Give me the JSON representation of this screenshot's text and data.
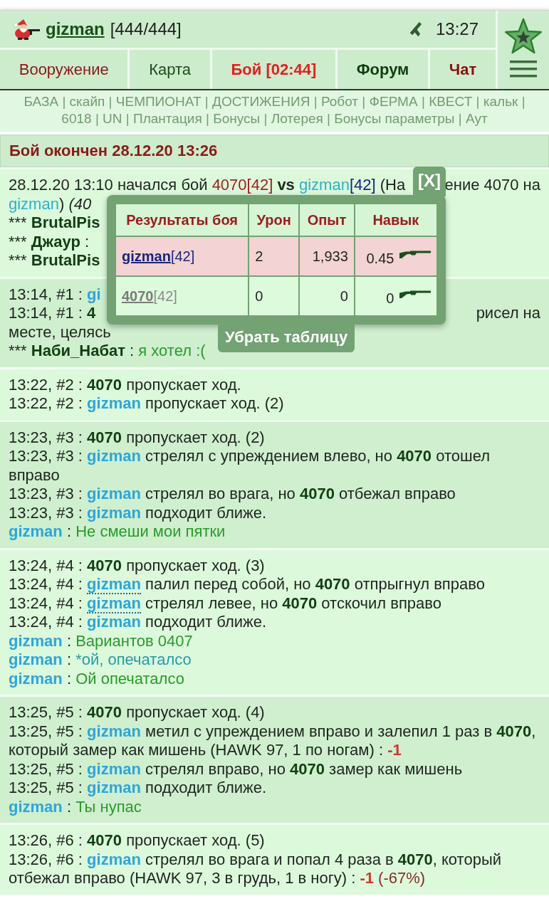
{
  "header": {
    "username": "gizman",
    "health": "[444/444]",
    "time": "13:27"
  },
  "nav": [
    {
      "label": "Вооружение",
      "color": "#8b1a1a",
      "bold": false
    },
    {
      "label": "Карта",
      "color": "#1b4d1b",
      "bold": false
    },
    {
      "label": "Бой [02:44]",
      "color": "#e02020",
      "bold": true
    },
    {
      "label": "Форум",
      "color": "#0f3d0f",
      "bold": true
    },
    {
      "label": "Чат",
      "color": "#8b1010",
      "bold": true
    }
  ],
  "links": {
    "items": [
      "БАЗА",
      "скайп",
      "ЧЕМПИОНАТ",
      "ДОСТИЖЕНИЯ",
      "Робот",
      "ФЕРМА",
      "КВЕСТ",
      "кальк",
      "6018",
      "UN",
      "Плантация",
      "Бонусы",
      "Лотерея",
      "Бонусы параметры",
      "Аут"
    ],
    "separator": "|"
  },
  "battle_title": "Бой окончен 28.12.20 13:26",
  "log": [
    {
      "lines": [
        {
          "segments": [
            {
              "text": "28.12.20 13:10 начался бой ",
              "kind": "plain"
            },
            {
              "text": "4070[42]",
              "kind": "red"
            },
            {
              "text": " vs ",
              "kind": "strong"
            },
            {
              "text": "gizman",
              "kind": "link"
            },
            {
              "text": "[42]",
              "kind": "rank"
            },
            {
              "text": " (На",
              "kind": "plain"
            }
          ],
          "after_cover": [
            {
              "text": "ение 4070 на",
              "kind": "plain"
            }
          ]
        },
        {
          "segments": [
            {
              "text": "gizman",
              "kind": "link"
            },
            {
              "text": ") ",
              "kind": "plain"
            },
            {
              "text": "(40",
              "kind": "italic"
            }
          ]
        },
        {
          "segments": [
            {
              "text": "*** ",
              "kind": "plain"
            },
            {
              "text": "BrutalPis",
              "kind": "name"
            }
          ]
        },
        {
          "segments": [
            {
              "text": "*** ",
              "kind": "plain"
            },
            {
              "text": "Джаур",
              "kind": "name"
            },
            {
              "text": " :",
              "kind": "plain"
            }
          ]
        },
        {
          "segments": [
            {
              "text": "*** ",
              "kind": "plain"
            },
            {
              "text": "BrutalPis",
              "kind": "name"
            }
          ]
        }
      ]
    },
    {
      "lines": [
        {
          "segments": [
            {
              "text": "13:14, #1 : ",
              "kind": "plain"
            },
            {
              "text": "gi",
              "kind": "nick"
            }
          ]
        },
        {
          "segments": [
            {
              "text": "13:14, #1 : ",
              "kind": "plain"
            },
            {
              "text": "4",
              "kind": "name"
            }
          ],
          "after_cover": [
            {
              "text": "рисел на",
              "kind": "plain"
            }
          ]
        },
        {
          "segments": [
            {
              "text": "месте, целясь",
              "kind": "plain"
            }
          ]
        },
        {
          "segments": [
            {
              "text": "*** ",
              "kind": "plain"
            },
            {
              "text": "Наби_Набат",
              "kind": "name"
            },
            {
              "text": " : ",
              "kind": "plain"
            },
            {
              "text": "я хотел :(",
              "kind": "chat"
            }
          ]
        }
      ]
    },
    {
      "lines": [
        {
          "segments": [
            {
              "text": "13:22, #2 : ",
              "kind": "plain"
            },
            {
              "text": "4070",
              "kind": "name"
            },
            {
              "text": " пропускает ход.",
              "kind": "plain"
            }
          ]
        },
        {
          "segments": [
            {
              "text": "13:22, #2 : ",
              "kind": "plain"
            },
            {
              "text": "gizman",
              "kind": "nick"
            },
            {
              "text": " пропускает ход. (2)",
              "kind": "plain"
            }
          ]
        }
      ]
    },
    {
      "lines": [
        {
          "segments": [
            {
              "text": "13:23, #3 : ",
              "kind": "plain"
            },
            {
              "text": "4070",
              "kind": "name"
            },
            {
              "text": " пропускает ход. (2)",
              "kind": "plain"
            }
          ]
        },
        {
          "segments": [
            {
              "text": "13:23, #3 : ",
              "kind": "plain"
            },
            {
              "text": "gizman",
              "kind": "nick"
            },
            {
              "text": " стрелял с упреждением влево, но ",
              "kind": "plain"
            },
            {
              "text": "4070",
              "kind": "name"
            },
            {
              "text": " отошел вправо",
              "kind": "plain"
            }
          ]
        },
        {
          "segments": [
            {
              "text": "13:23, #3 : ",
              "kind": "plain"
            },
            {
              "text": "gizman",
              "kind": "nick"
            },
            {
              "text": " стрелял во врага, но ",
              "kind": "plain"
            },
            {
              "text": "4070",
              "kind": "name"
            },
            {
              "text": " отбежал вправо",
              "kind": "plain"
            }
          ]
        },
        {
          "segments": [
            {
              "text": "13:23, #3 : ",
              "kind": "plain"
            },
            {
              "text": "gizman",
              "kind": "nick"
            },
            {
              "text": " подходит ближе.",
              "kind": "plain"
            }
          ]
        },
        {
          "segments": [
            {
              "text": "gizman",
              "kind": "nick"
            },
            {
              "text": " : ",
              "kind": "plain"
            },
            {
              "text": "Не смеши мои пятки",
              "kind": "chat"
            }
          ]
        }
      ]
    },
    {
      "lines": [
        {
          "segments": [
            {
              "text": "13:24, #4 : ",
              "kind": "plain"
            },
            {
              "text": "4070",
              "kind": "name"
            },
            {
              "text": " пропускает ход. (3)",
              "kind": "plain"
            }
          ]
        },
        {
          "segments": [
            {
              "text": "13:24, #4 : ",
              "kind": "plain"
            },
            {
              "text": "gizman",
              "kind": "nick_dotted"
            },
            {
              "text": " палил перед собой, но ",
              "kind": "plain"
            },
            {
              "text": "4070",
              "kind": "name"
            },
            {
              "text": " отпрыгнул вправо",
              "kind": "plain"
            }
          ]
        },
        {
          "segments": [
            {
              "text": "13:24, #4 : ",
              "kind": "plain"
            },
            {
              "text": "gizman",
              "kind": "nick_dotted"
            },
            {
              "text": " стрелял левее, но ",
              "kind": "plain"
            },
            {
              "text": "4070",
              "kind": "name"
            },
            {
              "text": " отскочил вправо",
              "kind": "plain"
            }
          ]
        },
        {
          "segments": [
            {
              "text": "13:24, #4 : ",
              "kind": "plain"
            },
            {
              "text": "gizman",
              "kind": "nick"
            },
            {
              "text": " подходит ближе.",
              "kind": "plain"
            }
          ]
        },
        {
          "segments": [
            {
              "text": "gizman",
              "kind": "nick"
            },
            {
              "text": " : ",
              "kind": "plain"
            },
            {
              "text": "Вариантов 0407",
              "kind": "chat"
            }
          ]
        },
        {
          "segments": [
            {
              "text": "gizman",
              "kind": "nick"
            },
            {
              "text": " : ",
              "kind": "plain"
            },
            {
              "text": "*ой, опечаталсо",
              "kind": "chat_alt"
            }
          ]
        },
        {
          "segments": [
            {
              "text": "gizman",
              "kind": "nick"
            },
            {
              "text": " : ",
              "kind": "plain"
            },
            {
              "text": "Ой опечаталсо",
              "kind": "chat"
            }
          ]
        }
      ]
    },
    {
      "lines": [
        {
          "segments": [
            {
              "text": "13:25, #5 : ",
              "kind": "plain"
            },
            {
              "text": "4070",
              "kind": "name"
            },
            {
              "text": " пропускает ход. (4)",
              "kind": "plain"
            }
          ]
        },
        {
          "segments": [
            {
              "text": "13:25, #5 : ",
              "kind": "plain"
            },
            {
              "text": "gizman",
              "kind": "nick"
            },
            {
              "text": " метил с упреждением вправо и залепил 1 раз в ",
              "kind": "plain"
            },
            {
              "text": "4070",
              "kind": "name"
            },
            {
              "text": ", который замер как мишень (HAWK 97, 1 по ногам) : ",
              "kind": "plain"
            },
            {
              "text": "-1",
              "kind": "damage"
            }
          ]
        },
        {
          "segments": [
            {
              "text": "13:25, #5 : ",
              "kind": "plain"
            },
            {
              "text": "gizman",
              "kind": "nick"
            },
            {
              "text": " стрелял вправо, но ",
              "kind": "plain"
            },
            {
              "text": "4070",
              "kind": "name"
            },
            {
              "text": " замер как мишень",
              "kind": "plain"
            }
          ]
        },
        {
          "segments": [
            {
              "text": "13:25, #5 : ",
              "kind": "plain"
            },
            {
              "text": "gizman",
              "kind": "nick"
            },
            {
              "text": " подходит ближе.",
              "kind": "plain"
            }
          ]
        },
        {
          "segments": [
            {
              "text": "gizman",
              "kind": "nick"
            },
            {
              "text": " : ",
              "kind": "plain"
            },
            {
              "text": "Ты нупас",
              "kind": "chat"
            }
          ]
        }
      ]
    },
    {
      "lines": [
        {
          "segments": [
            {
              "text": "13:26, #6 : ",
              "kind": "plain"
            },
            {
              "text": "4070",
              "kind": "name"
            },
            {
              "text": " пропускает ход. (5)",
              "kind": "plain"
            }
          ]
        },
        {
          "segments": [
            {
              "text": "13:26, #6 : ",
              "kind": "plain"
            },
            {
              "text": "gizman",
              "kind": "nick"
            },
            {
              "text": " стрелял во врага и попал 4 раза в ",
              "kind": "plain"
            },
            {
              "text": "4070",
              "kind": "name"
            },
            {
              "text": ", который отбежал вправо (HAWK 97, 3 в грудь, 1 в ногу) : ",
              "kind": "plain"
            },
            {
              "text": "-1",
              "kind": "damage"
            },
            {
              "text": " (-67%)",
              "kind": "damage_note"
            }
          ]
        }
      ]
    }
  ],
  "results_popup": {
    "close_label": "[X]",
    "columns": [
      "Результаты боя",
      "Урон",
      "Опыт",
      "Навык"
    ],
    "rows": [
      {
        "name": "gizman",
        "rank": "[42]",
        "damage": "2",
        "experience": "1,933",
        "skill": "0.45",
        "highlighted": true
      },
      {
        "name": "4070",
        "rank": "[42]",
        "damage": "0",
        "experience": "0",
        "skill": "0",
        "highlighted": false
      }
    ],
    "hide_button": "Убрать таблицу"
  }
}
